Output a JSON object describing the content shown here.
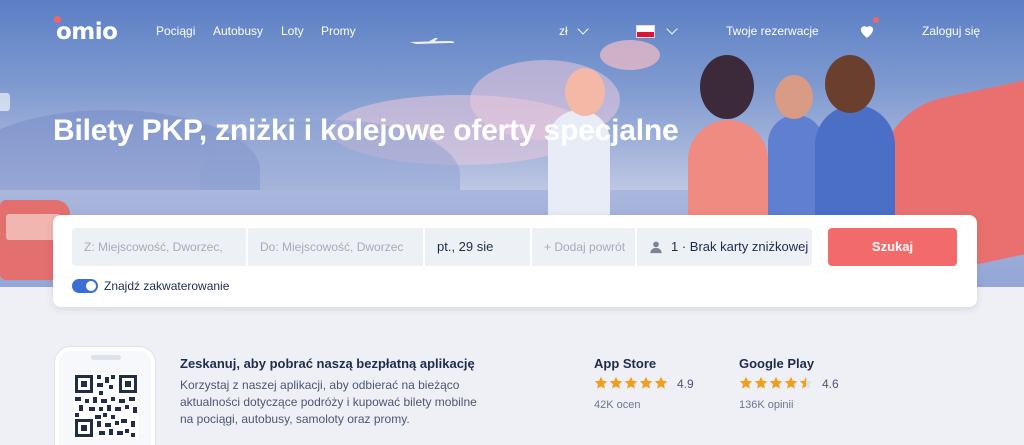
{
  "nav": {
    "logo": "omio",
    "links": [
      "Pociągi",
      "Autobusy",
      "Loty",
      "Promy"
    ],
    "currency": "zł",
    "reservations": "Twoje rezerwacje",
    "login": "Zaloguj się"
  },
  "hero": {
    "title": "Bilety PKP, zniżki i kolejowe oferty specjalne"
  },
  "search": {
    "from_placeholder": "Z: Miejscowość, Dworzec,",
    "to_placeholder": "Do: Miejscowość, Dworzec",
    "date": "pt., 29 sie",
    "return_placeholder": "+ Dodaj powrót",
    "passengers": "1 · Brak karty zniżkowej",
    "submit": "Szukaj",
    "accommodation_toggle": "Znajdź zakwaterowanie",
    "accommodation_on": true
  },
  "app_promo": {
    "title": "Zeskanuj, aby pobrać naszą bezpłatną aplikację",
    "text": "Korzystaj z naszej aplikacji, aby odbierać na bieżąco aktualności dotyczące podróży i kupować bilety mobilne na pociągi, autobusy, samoloty oraz promy."
  },
  "stores": [
    {
      "name": "App Store",
      "rating": "4.9",
      "stars": 5,
      "reviews": "42K ocen"
    },
    {
      "name": "Google Play",
      "rating": "4.6",
      "stars": 4.5,
      "reviews": "136K opinii"
    }
  ],
  "colors": {
    "accent": "#f26a6a",
    "brand_blue": "#3b6fd6",
    "text_dark": "#1f2d4b",
    "star": "#f0a020"
  }
}
